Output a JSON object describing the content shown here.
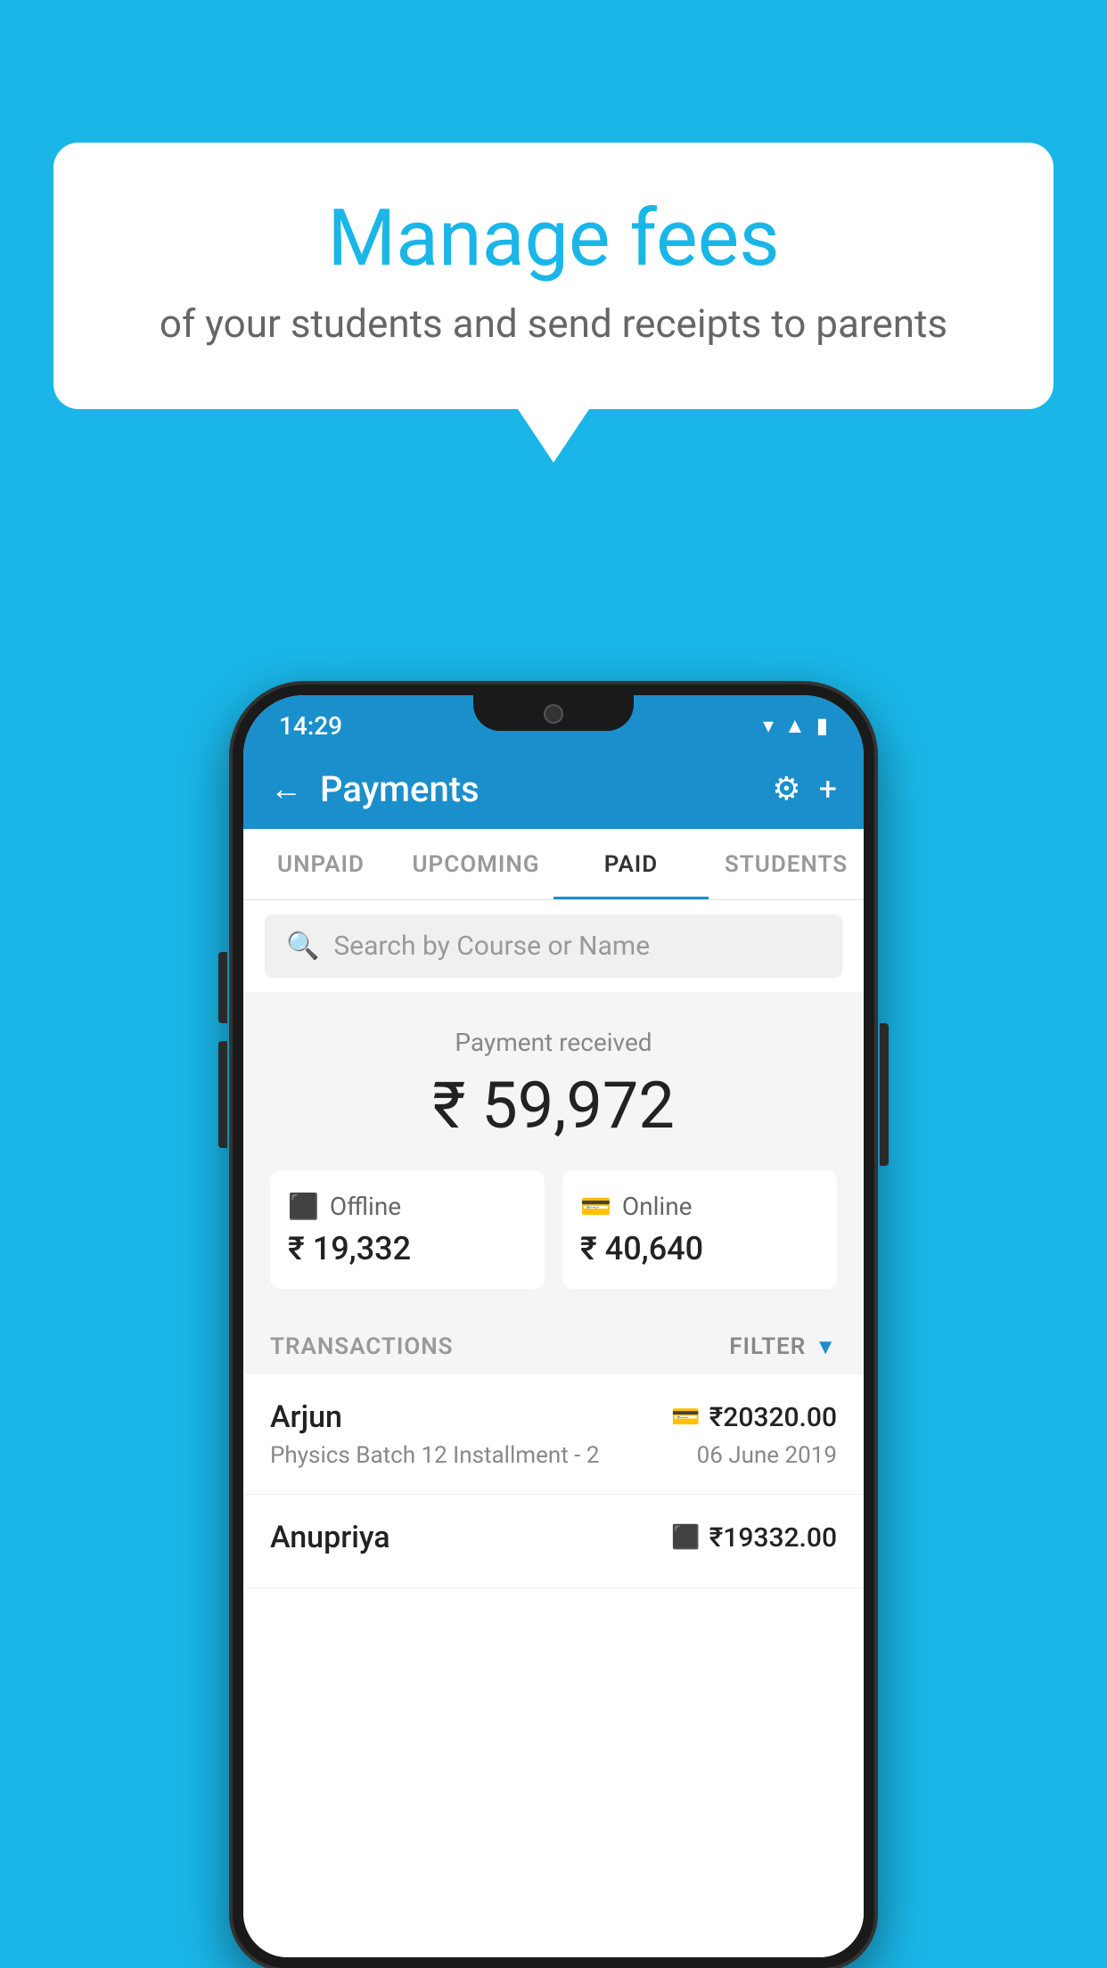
{
  "background_color": "#1ab6e8",
  "speech_bubble": {
    "title": "Manage fees",
    "subtitle": "of your students and send receipts to parents"
  },
  "status_bar": {
    "time": "14:29",
    "icons": [
      "wifi",
      "signal",
      "battery"
    ]
  },
  "app_bar": {
    "title": "Payments",
    "back_label": "←",
    "settings_label": "⚙",
    "add_label": "+"
  },
  "tabs": [
    {
      "label": "UNPAID",
      "active": false
    },
    {
      "label": "UPCOMING",
      "active": false
    },
    {
      "label": "PAID",
      "active": true
    },
    {
      "label": "STUDENTS",
      "active": false
    }
  ],
  "search": {
    "placeholder": "Search by Course or Name"
  },
  "payment_summary": {
    "label": "Payment received",
    "total": "₹ 59,972",
    "offline": {
      "icon": "offline",
      "label": "Offline",
      "amount": "₹ 19,332"
    },
    "online": {
      "icon": "online",
      "label": "Online",
      "amount": "₹ 40,640"
    }
  },
  "transactions": {
    "header_label": "TRANSACTIONS",
    "filter_label": "FILTER",
    "items": [
      {
        "name": "Arjun",
        "description": "Physics Batch 12 Installment - 2",
        "amount": "₹20320.00",
        "date": "06 June 2019",
        "payment_type": "online"
      },
      {
        "name": "Anupriya",
        "description": "",
        "amount": "₹19332.00",
        "date": "",
        "payment_type": "offline"
      }
    ]
  }
}
